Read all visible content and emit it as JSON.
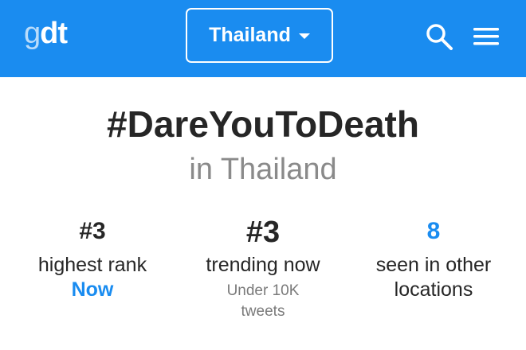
{
  "header": {
    "logo_g": "g",
    "logo_dt": "dt",
    "country": "Thailand",
    "brand_color": "#1a8cf0",
    "icons": [
      "search-icon",
      "menu-icon",
      "chevron-down-icon"
    ]
  },
  "trend": {
    "hashtag": "#DareYouToDeath",
    "location": "in Thailand"
  },
  "stats": {
    "highest": {
      "value": "#3",
      "caption": "highest rank",
      "link": "Now"
    },
    "trending": {
      "value": "#3",
      "caption": "trending now",
      "note_line1": "Under 10K",
      "note_line2": "tweets"
    },
    "seen": {
      "value": "8",
      "caption_line1": "seen in other",
      "caption_line2": "locations"
    }
  }
}
